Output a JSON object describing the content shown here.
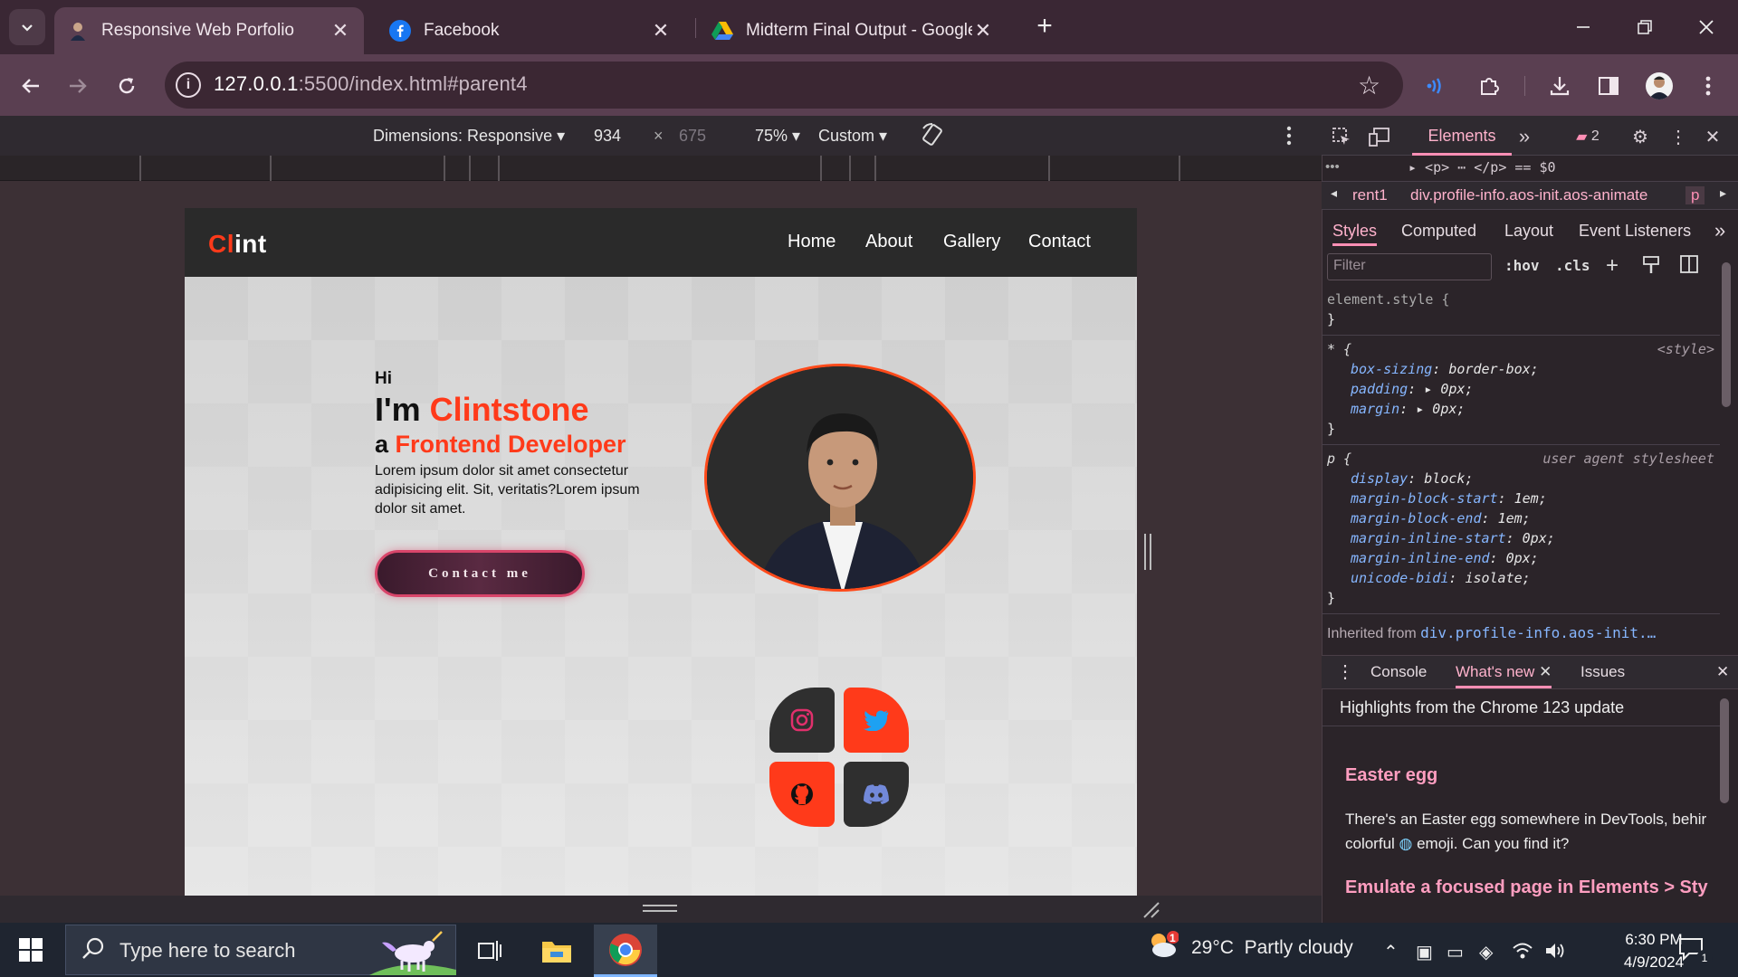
{
  "browser": {
    "tabs": [
      {
        "title": "Responsive Web Porfolio",
        "active": true
      },
      {
        "title": "Facebook",
        "active": false
      },
      {
        "title": "Midterm Final Output - Google",
        "active": false
      }
    ],
    "url_host": "127.0.0.1",
    "url_rest": ":5500/index.html#parent4"
  },
  "device_toolbar": {
    "dimensions": "Dimensions: Responsive",
    "width": "934",
    "height": "675",
    "zoom": "75%",
    "throttle": "Custom"
  },
  "site": {
    "logo_first": "Cl",
    "logo_rest": "int",
    "nav": [
      "Home",
      "About",
      "Gallery",
      "Contact"
    ],
    "hi": "Hi",
    "im_prefix": "I'm ",
    "name": "Clintstone",
    "role_prefix": "a ",
    "role": "Frontend Developer",
    "lorem": "Lorem ipsum dolor sit amet consectetur adipisicing elit. Sit, veritatis?Lorem ipsum dolor sit amet.",
    "contact_button": "Contact me",
    "socials": [
      "instagram",
      "twitter",
      "github",
      "discord"
    ]
  },
  "devtools": {
    "tab_elements": "Elements",
    "issues_count": "2",
    "dom_line": "▸ <p> ⋯ </p> == $0",
    "breadcrumb_1": "rent1",
    "breadcrumb_2": "div.profile-info.aos-init.aos-animate",
    "breadcrumb_3": "p",
    "subtabs": [
      "Styles",
      "Computed",
      "Layout",
      "Event Listeners"
    ],
    "filter_placeholder": "Filter",
    "hov": ":hov",
    "cls": ".cls",
    "element_style": "element.style {",
    "close_brace": "}",
    "rule1_selector": "* {",
    "rule1_source": "<style>",
    "rule1_props": [
      {
        "name": "box-sizing",
        "value": "border-box;"
      },
      {
        "name": "padding",
        "value": "▸ 0px;"
      },
      {
        "name": "margin",
        "value": "▸ 0px;"
      }
    ],
    "rule2_selector": "p {",
    "rule2_source": "user agent stylesheet",
    "rule2_props": [
      {
        "name": "display",
        "value": "block;"
      },
      {
        "name": "margin-block-start",
        "value": "1em;"
      },
      {
        "name": "margin-block-end",
        "value": "1em;"
      },
      {
        "name": "margin-inline-start",
        "value": "0px;"
      },
      {
        "name": "margin-inline-end",
        "value": "0px;"
      },
      {
        "name": "unicode-bidi",
        "value": "isolate;"
      }
    ],
    "inherited_label": "Inherited from ",
    "inherited_class": "div.profile-info.aos-init.…",
    "drawer_tabs": [
      "Console",
      "What's new",
      "Issues"
    ],
    "whats_new_heading": "Highlights from the Chrome 123 update",
    "easter_title": "Easter egg",
    "easter_text_1": "There's an Easter egg somewhere in DevTools, behir",
    "easter_text_2a": "colorful ",
    "easter_text_2b": " emoji. Can you find it?",
    "emulate_title": "Emulate a focused page in Elements > Sty"
  },
  "taskbar": {
    "search_placeholder": "Type here to search",
    "temperature": "29°C",
    "weather": "Partly cloudy",
    "weather_badge": "1",
    "time": "6:30 PM",
    "date": "4/9/2024",
    "notifications": "1"
  },
  "colors": {
    "accent_orange": "#ff3a1a",
    "devtools_pink": "#ffb2cc",
    "instagram": "#e1306c",
    "twitter": "#1da1f2",
    "discord": "#7289da"
  }
}
